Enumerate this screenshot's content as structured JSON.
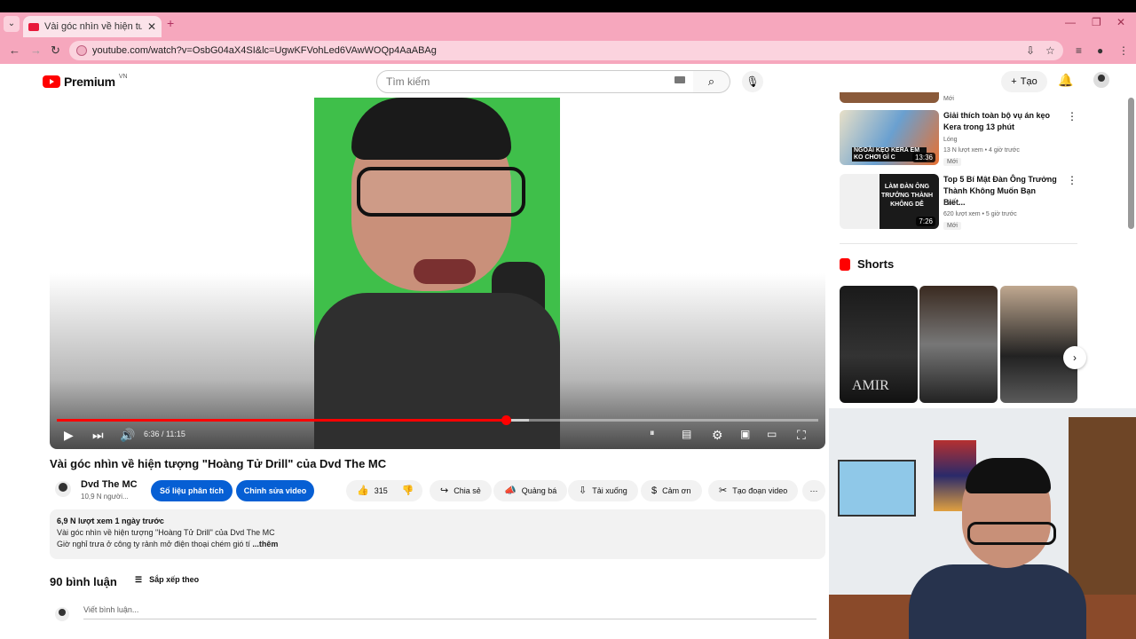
{
  "browser": {
    "tab_title": "Vài góc nhìn về hiện tượng \"Ho",
    "url": "youtube.com/watch?v=OsbG04aX4SI&lc=UgwKFVohLed6VAwWOQp4AaABAg"
  },
  "header": {
    "logo_text": "Premium",
    "region": "VN",
    "search_placeholder": "Tìm kiếm",
    "create_label": "Tạo"
  },
  "player": {
    "time": "6:36 / 11:15",
    "played_fraction": 0.59,
    "buffered_fraction": 0.62
  },
  "video": {
    "title": "Vài góc nhìn về hiện tượng \"Hoàng Tử Drill\" của Dvd The MC",
    "channel": "Dvd The MC",
    "subs": "10,9 N người...",
    "analytics_btn": "Số liệu phân tích",
    "edit_btn": "Chỉnh sửa video",
    "likes": "315",
    "share": "Chia sẻ",
    "promote": "Quảng bá",
    "download": "Tải xuống",
    "thanks": "Cảm ơn",
    "clip": "Tạo đoạn video"
  },
  "description": {
    "stats": "6,9 N lượt xem  1 ngày trước",
    "line1": "Vài góc nhìn về hiện tượng \"Hoàng Tử Drill\" của Dvd The MC",
    "line2": "Giờ nghỉ trưa ở công ty rảnh mở điện thoại chém gió tí",
    "more": "...thêm"
  },
  "comments": {
    "count": "90 bình luận",
    "sort": "Sắp xếp theo",
    "placeholder": "Viết bình luận..."
  },
  "sidebar": {
    "top_badge": "Mới",
    "recs": [
      {
        "title": "Giải thích toàn bộ vụ án kẹo Kera trong 13 phút",
        "channel": "Lóng",
        "meta": "13 N lượt xem  •  4 giờ trước",
        "badge": "Mới",
        "duration": "13:36",
        "thumb_text": "NGOÀI KẸO KERA EM KO CHƠI GÌ C"
      },
      {
        "title": "Top 5 Bí Mật Đàn Ông Trưởng Thành Không Muốn Bạn Biết...",
        "channel": "Lai H.",
        "meta": "620 lượt xem  •  5 giờ trước",
        "badge": "Mới",
        "duration": "7:26",
        "thumb_text": "LÀM ĐÀN ÔNG TRƯỞNG THÀNH KHÔNG DỄ"
      }
    ],
    "shorts_title": "Shorts",
    "short1_text": "AMIR"
  },
  "colors": {
    "accent_red": "#ff0000",
    "brand_blue": "#065fd4",
    "tab_pink": "#f6a7bd"
  }
}
